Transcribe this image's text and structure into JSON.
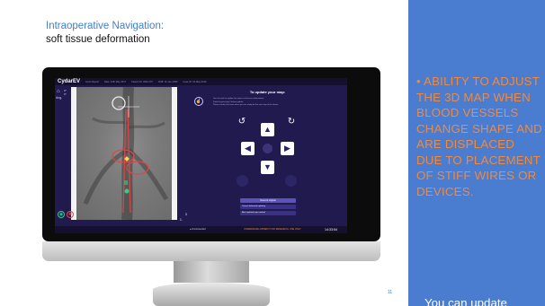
{
  "slide": {
    "title": "Intraoperative Navigation:",
    "subtitle": "soft tissue deformation",
    "slide_number": "11",
    "bullet": "ABILITY TO ADJUST THE 3D MAP WHEN BLOOD VESSELS CHANGE SHAPE AND ARE DISPLACED DUE TO PLACEMENT OF STIFF WIRES OR DEVICES.",
    "bullet_marker": "•",
    "sub_bullet": "You can update"
  },
  "app": {
    "logo": "CydarEV",
    "meta": [
      "Aortic Repair",
      "Date: 10th May 2017",
      "Patient ID: 4664 475",
      "DOB: 01-Jan-1958",
      "Case ID: 16-May-2019"
    ],
    "angle_label": "Ang.",
    "angle_values": [
      "0°",
      "0°"
    ],
    "frame_numbers": [
      "3",
      "1."
    ],
    "controls": {
      "title": "To update your map:",
      "instructions": [
        "Use the tools to update the map to soft tissue deformation.",
        "Finish by pressing Confirm update.",
        "Please contact the team when you are ready for the next step to be shown."
      ],
      "rotate_left_icon": "rotate-ccw-icon",
      "rotate_right_icon": "rotate-cw-icon",
      "arrow_up": "▲",
      "arrow_down": "▼",
      "arrow_left": "◀",
      "arrow_right": "▶",
      "reset_label": "Reset to original",
      "option_1": "Correct deformed updating",
      "option_2": "Alert updated map marked"
    },
    "status": {
      "left": "● Unconnected",
      "mid": "UNDERDEVELOPMENT FOR RESEARCH USE ONLY",
      "right": "14:33:54"
    }
  },
  "colors": {
    "accent_blue": "#4a7cd0",
    "orange": "#f3893a",
    "app_bg": "#201a4e"
  }
}
